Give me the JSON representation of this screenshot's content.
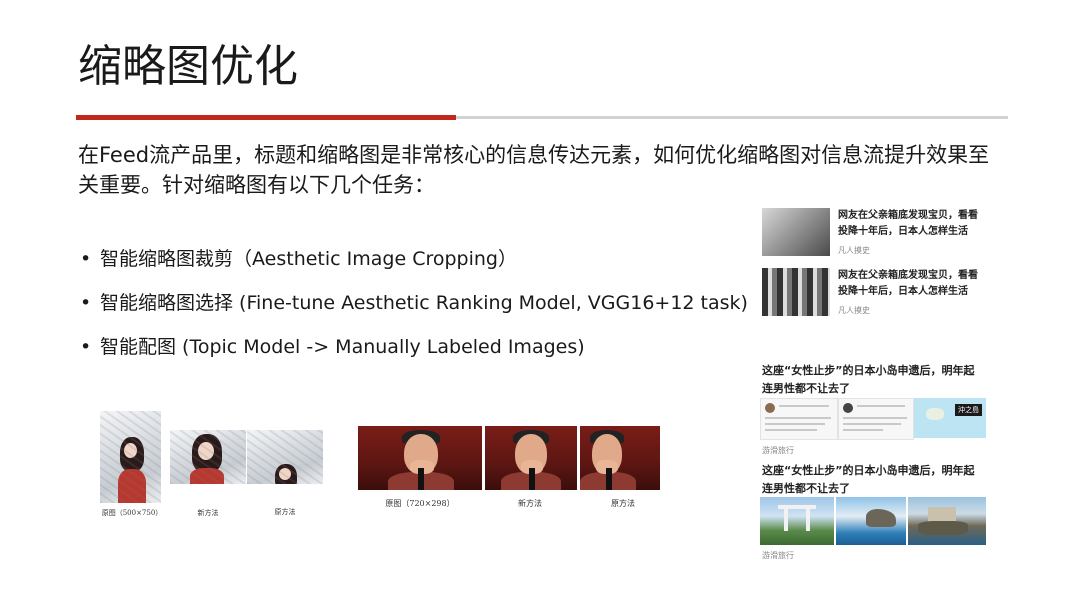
{
  "slide": {
    "title": "缩略图优化",
    "intro": "在Feed流产品里，标题和缩略图是非常核心的信息传达元素，如何优化缩略图对信息流提升效果至关重要。针对缩略图有以下几个任务：",
    "bullets": [
      "智能缩略图裁剪（Aesthetic Image Cropping）",
      "智能缩略图选择 (Fine-tune Aesthetic Ranking Model, VGG16+12 task)",
      "智能配图 (Topic Model -> Manually Labeled Images)"
    ],
    "accent_color": "#c0281c"
  },
  "crop_example_1": {
    "captions": [
      "原图（500×750）",
      "新方法",
      "原方法"
    ]
  },
  "crop_example_2": {
    "captions": [
      "原图（720×298）",
      "新方法",
      "原方法"
    ]
  },
  "feed": {
    "items": [
      {
        "title": "网友在父亲箱底发现宝贝，看看投降十年后，日本人怎样生活",
        "source": "凡人摸史"
      },
      {
        "title": "网友在父亲箱底发现宝贝，看看投降十年后，日本人怎样生活",
        "source": "凡人摸史"
      }
    ],
    "big_items": [
      {
        "title": "这座“女性止步”的日本小岛申遗后，明年起连男性都不让去了",
        "source": "游滑旅行",
        "map_label": "沖之島"
      },
      {
        "title": "这座“女性止步”的日本小岛申遗后，明年起连男性都不让去了",
        "source": "游滑旅行"
      }
    ]
  }
}
